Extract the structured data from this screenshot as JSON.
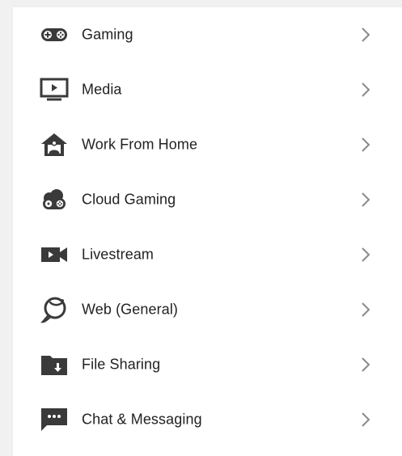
{
  "colors": {
    "icon": "#3a3a3a",
    "text": "#222222",
    "chevron": "#8a8a8a",
    "background": "#f1f1f1",
    "panel": "#ffffff"
  },
  "menu": {
    "items": [
      {
        "label": "Gaming",
        "icon": "gamepad-icon"
      },
      {
        "label": "Media",
        "icon": "tv-play-icon"
      },
      {
        "label": "Work From Home",
        "icon": "home-person-icon"
      },
      {
        "label": "Cloud Gaming",
        "icon": "cloud-gamepad-icon"
      },
      {
        "label": "Livestream",
        "icon": "video-camera-icon"
      },
      {
        "label": "Web (General)",
        "icon": "globe-icon"
      },
      {
        "label": "File Sharing",
        "icon": "folder-download-icon"
      },
      {
        "label": "Chat & Messaging",
        "icon": "chat-bubble-icon"
      }
    ]
  }
}
